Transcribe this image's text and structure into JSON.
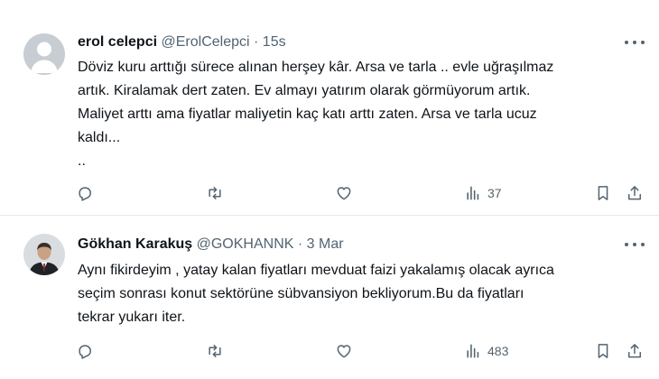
{
  "colors": {
    "text": "#0f1419",
    "secondary": "#536471",
    "divider": "#e6e9eb"
  },
  "tweets": [
    {
      "author": "erol celepci",
      "handle": "@ErolCelepci",
      "separator": "·",
      "time": "15s",
      "avatar": "default-avatar",
      "text": "Döviz kuru arttığı sürece alınan herşey kâr. Arsa ve tarla .. evle uğraşılmaz\nartık. Kiralamak dert zaten. Ev almayı yatırım olarak görmüyorum artık.\nMaliyet arttı ama fiyatlar maliyetin kaç katı arttı zaten. Arsa ve tarla ucuz\nkaldı...\n..",
      "views": "37"
    },
    {
      "author": "Gökhan Karakuş",
      "handle": "@GOKHANNK",
      "separator": "·",
      "time": "3 Mar",
      "avatar": "profile-photo",
      "text": "Aynı fikirdeyim , yatay kalan fiyatları mevduat faizi yakalamış olacak ayrıca\nseçim sonrası konut sektörüne sübvansiyon bekliyorum.Bu da fiyatları\ntekrar yukarı iter.",
      "views": "483"
    }
  ]
}
